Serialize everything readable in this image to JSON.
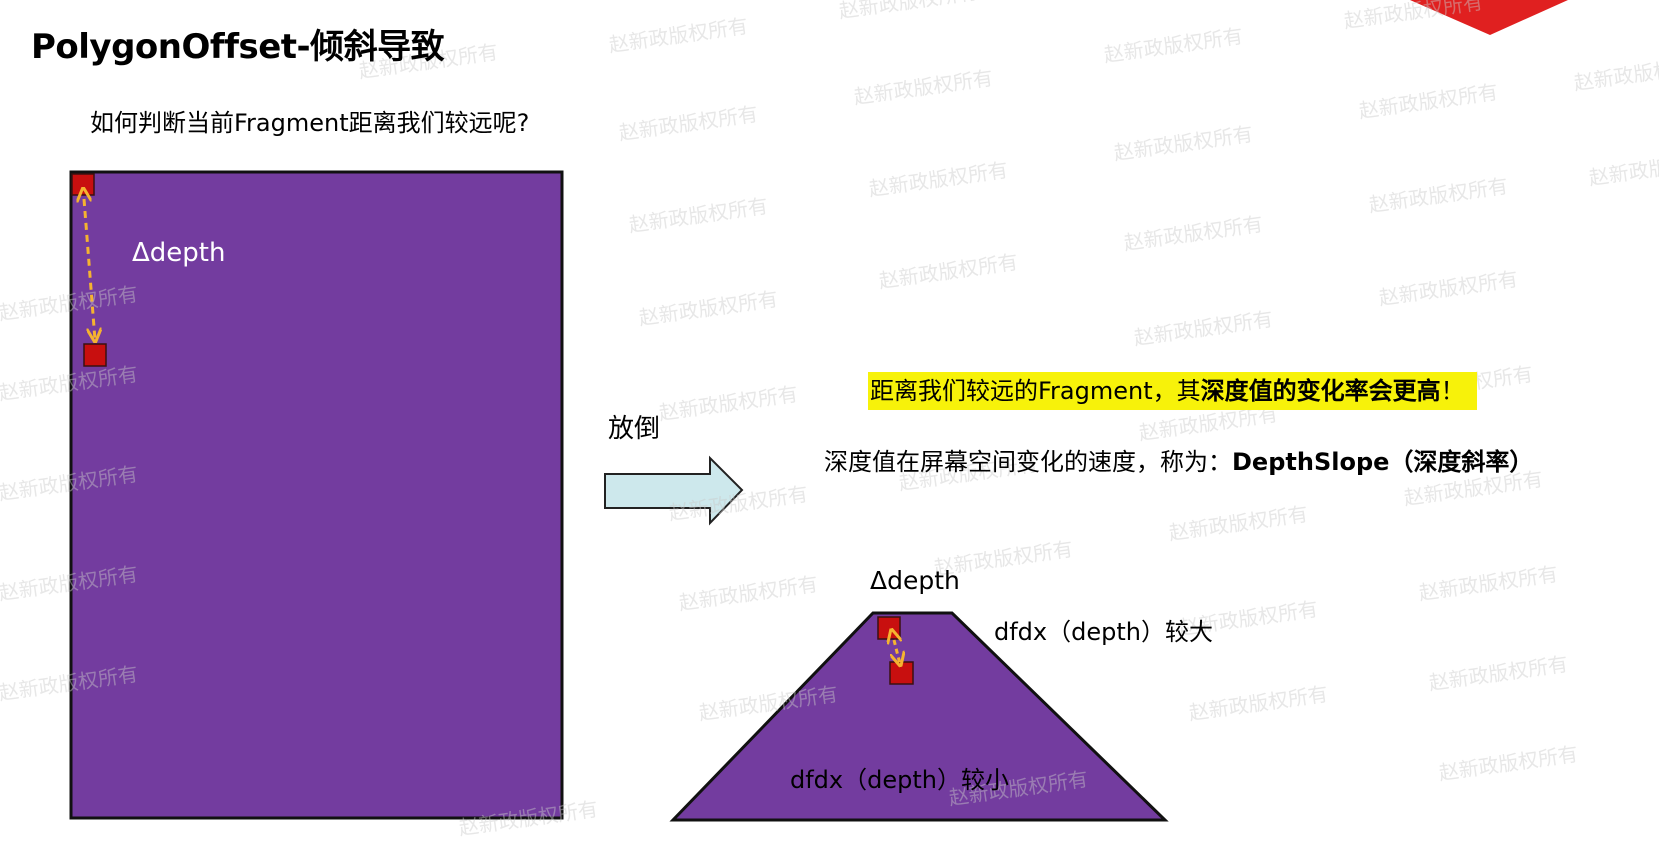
{
  "slide": {
    "title": "PolygonOffset-倾斜导致",
    "question": "如何判断当前Fragment距离我们较远呢?"
  },
  "rect_diagram": {
    "delta_label": "Δdepth"
  },
  "transition": {
    "label": "放倒"
  },
  "highlight": {
    "lead": "距离我们较远的Fragment，其",
    "bold": "深度值的变化率会更高",
    "tail": "！"
  },
  "depth_slope": {
    "text": "深度值在屏幕空间变化的速度，称为：",
    "bold": "DepthSlope（深度斜率）"
  },
  "trapezoid_diagram": {
    "delta_label": "Δdepth",
    "top_label": "dfdx（depth）较大",
    "bottom_label": "dfdx（depth）较小"
  },
  "watermark": {
    "text": "赵新政版权所有"
  },
  "colors": {
    "shape_fill": "#733c9f",
    "marker_fill": "#c80f0f",
    "arrow_dash": "#f5b330",
    "block_arrow_fill": "#cde8ec",
    "highlight_bg": "#f7f20a",
    "corner_shape": "#e02020"
  }
}
